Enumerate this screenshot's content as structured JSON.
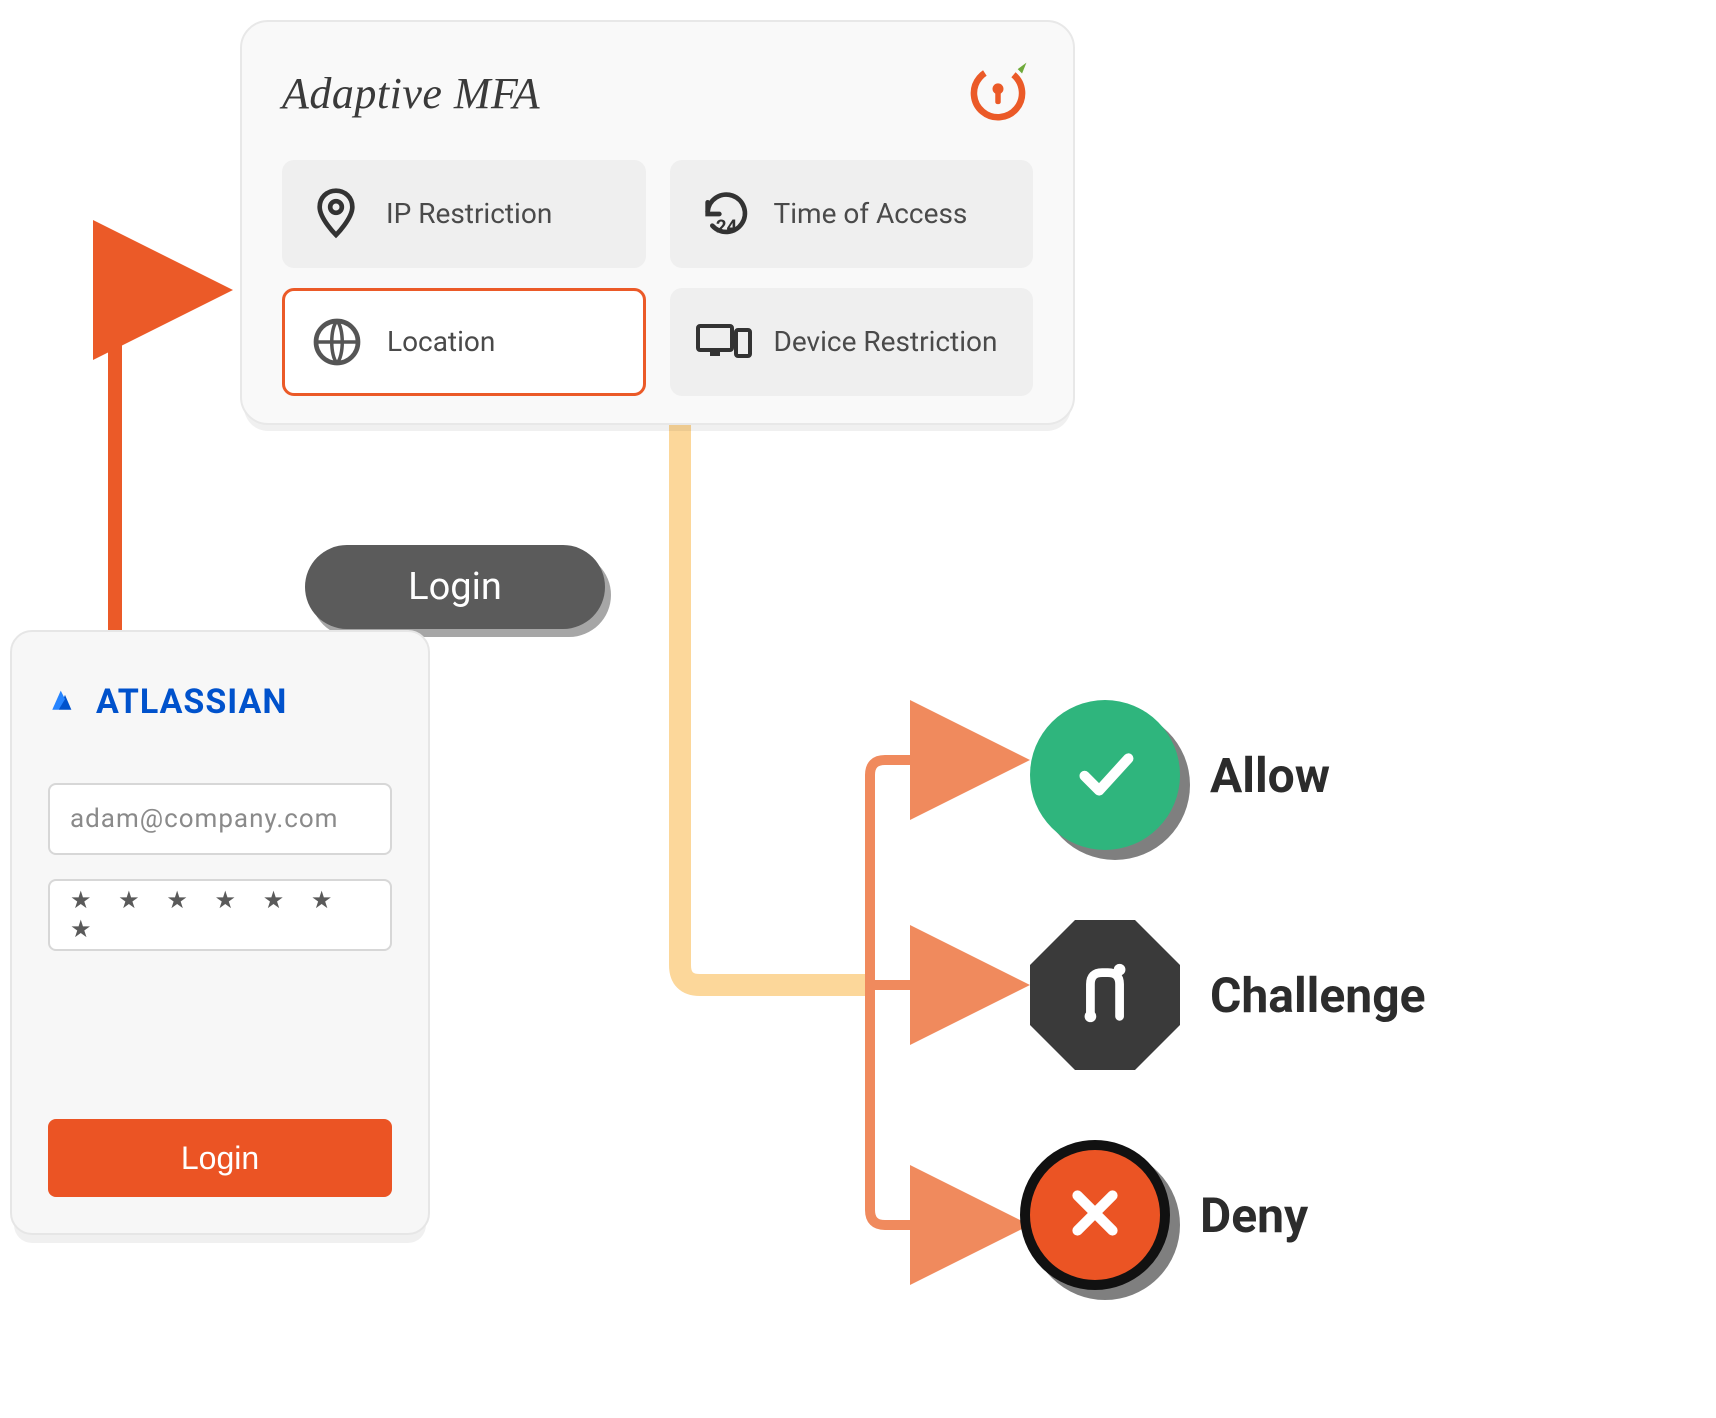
{
  "mfa": {
    "title": "Adaptive MFA",
    "chips": {
      "ip": {
        "label": "IP Restriction"
      },
      "time": {
        "label": "Time of Access"
      },
      "location": {
        "label": "Location"
      },
      "device": {
        "label": "Device Restriction"
      }
    }
  },
  "flow_label": "Login",
  "login_form": {
    "brand": "ATLASSIAN",
    "email_value": "adam@company.com",
    "password_mask": "★ ★ ★ ★ ★ ★ ★",
    "submit_label": "Login"
  },
  "outcomes": {
    "allow": {
      "label": "Allow"
    },
    "challenge": {
      "label": "Challenge"
    },
    "deny": {
      "label": "Deny"
    }
  },
  "colors": {
    "accent_orange": "#eb5424",
    "allow_green": "#2fb57d",
    "challenge_gray": "#3a3a3a",
    "brand_blue": "#0052cc"
  }
}
